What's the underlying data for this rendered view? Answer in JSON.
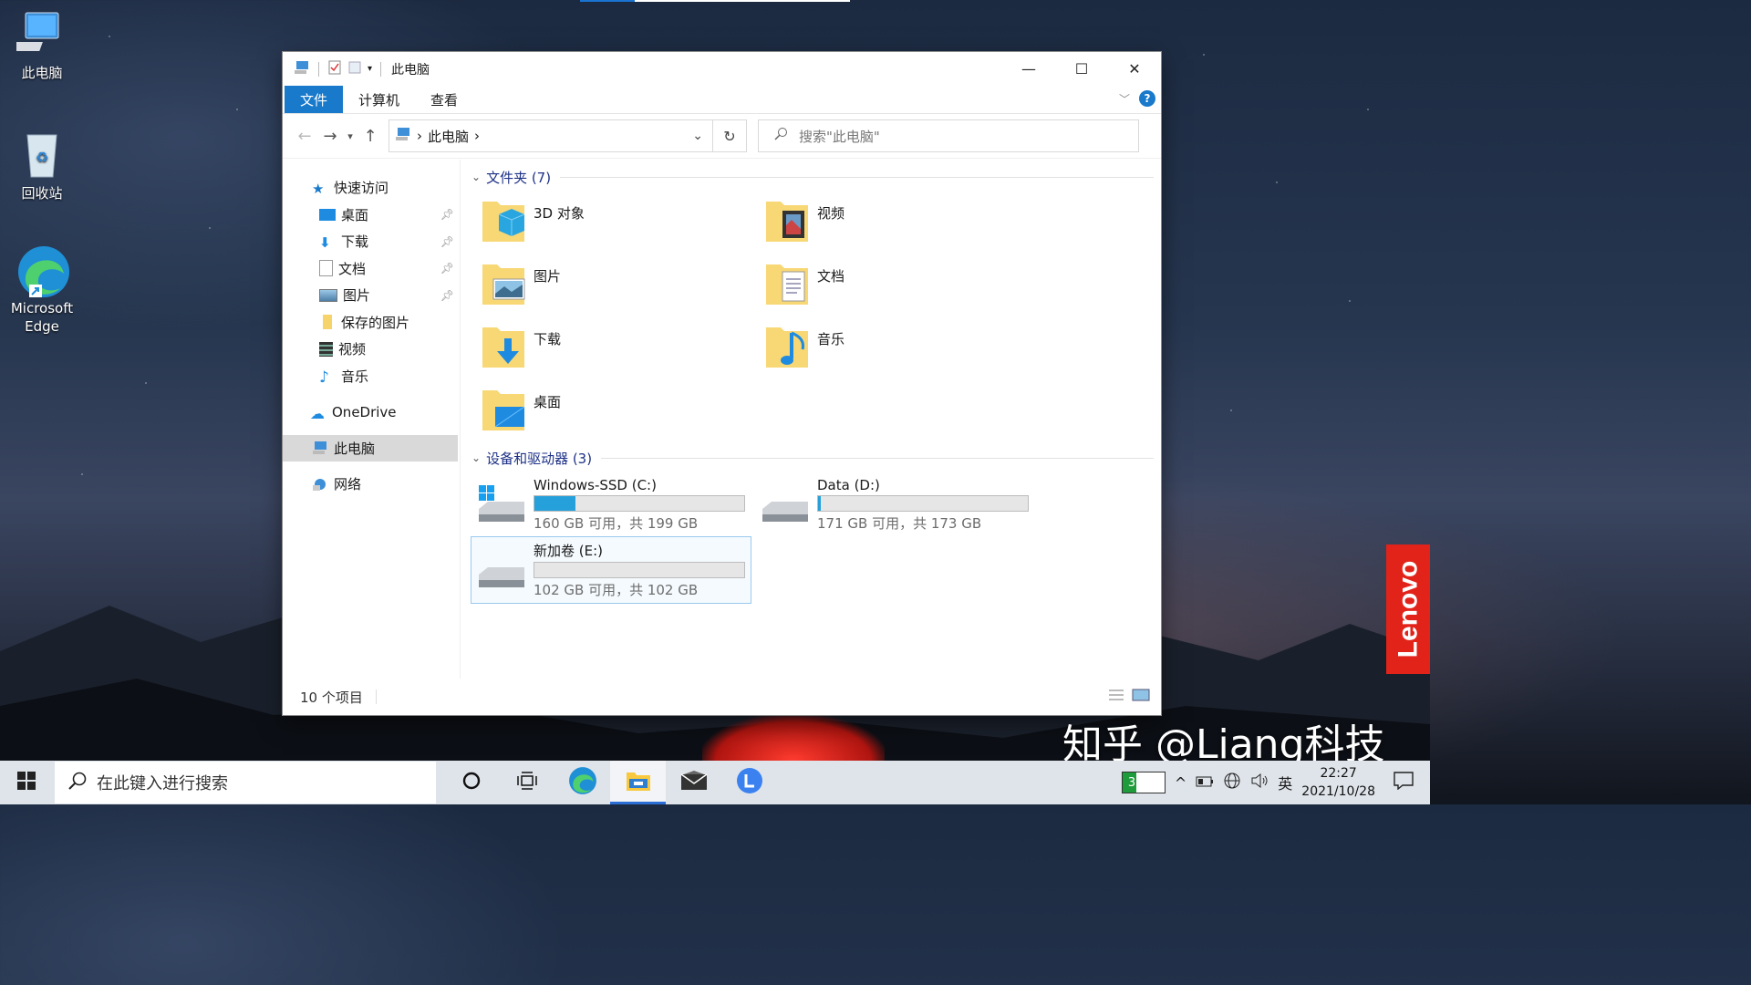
{
  "desktop": {
    "icons": [
      {
        "label": "此电脑"
      },
      {
        "label": "回收站"
      },
      {
        "label": "Microsoft Edge"
      }
    ],
    "brand_text": "Lenovo",
    "watermark": "知乎 @Liang科技"
  },
  "window": {
    "title": "此电脑",
    "controls": {
      "minimize": "—",
      "maximize": "☐",
      "close": "✕"
    },
    "ribbon_tabs": [
      "文件",
      "计算机",
      "查看"
    ],
    "help": "?",
    "address": {
      "crumb": "此电脑",
      "sep": "›"
    },
    "search_placeholder": "搜索\"此电脑\"",
    "nav_pane": {
      "quick_access": "快速访问",
      "items": [
        {
          "label": "桌面",
          "pinned": true
        },
        {
          "label": "下载",
          "pinned": true
        },
        {
          "label": "文档",
          "pinned": true
        },
        {
          "label": "图片",
          "pinned": true
        },
        {
          "label": "保存的图片",
          "pinned": false
        },
        {
          "label": "视频",
          "pinned": false
        },
        {
          "label": "音乐",
          "pinned": false
        }
      ],
      "onedrive": "OneDrive",
      "this_pc": "此电脑",
      "network": "网络"
    },
    "folders_header": "文件夹 (7)",
    "folders": [
      "3D 对象",
      "视频",
      "图片",
      "文档",
      "下载",
      "音乐",
      "桌面"
    ],
    "drives_header": "设备和驱动器 (3)",
    "drives": [
      {
        "name": "Windows-SSD (C:)",
        "detail": "160 GB 可用，共 199 GB",
        "used_fraction": 0.196
      },
      {
        "name": "Data (D:)",
        "detail": "171 GB 可用，共 173 GB",
        "used_fraction": 0.012
      },
      {
        "name": "新加卷 (E:)",
        "detail": "102 GB 可用，共 102 GB",
        "used_fraction": 0.0
      }
    ],
    "status": "10 个项目"
  },
  "taskbar": {
    "search_placeholder": "在此键入进行搜索",
    "battery": "32%",
    "ime": "英",
    "time": "22:27",
    "date": "2021/10/28"
  },
  "colors": {
    "accent": "#1979ca",
    "drive_bar": "#26a0da",
    "brand": "#e2231a"
  }
}
